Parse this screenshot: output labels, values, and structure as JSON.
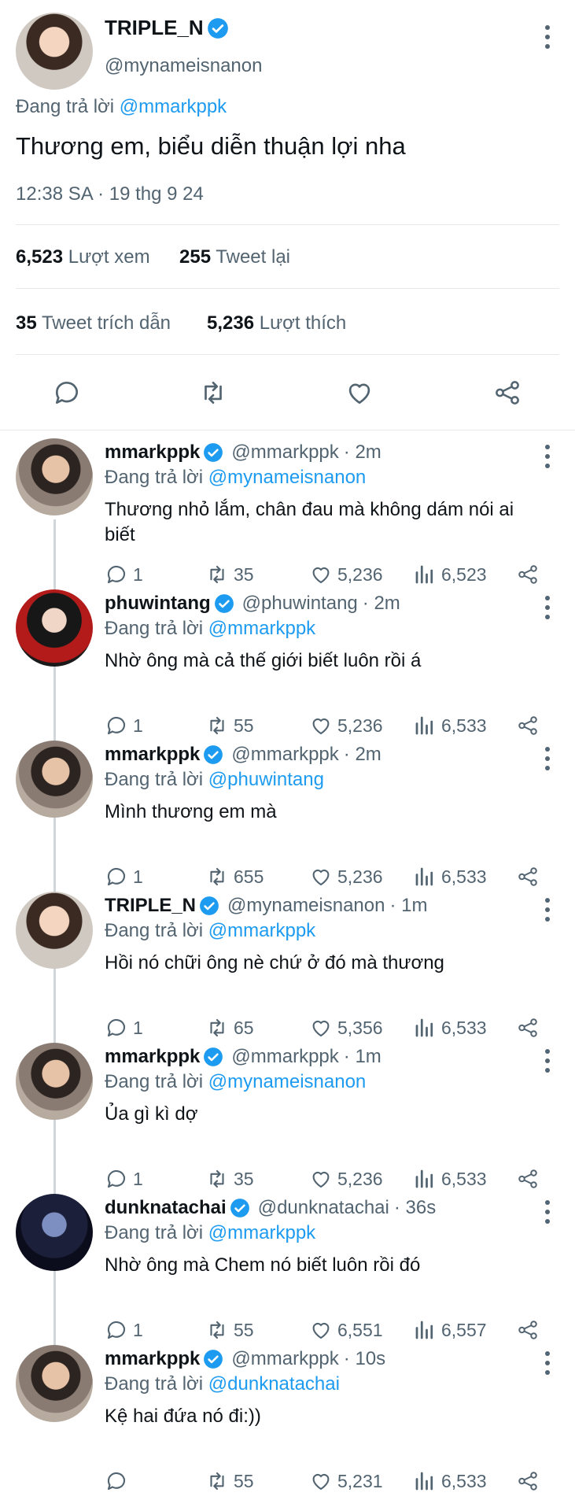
{
  "main_tweet": {
    "display_name": "TRIPLE_N",
    "handle": "@mynameisnanon",
    "reply_prefix": "Đang trả lời",
    "reply_to": "@mmarkppk",
    "text": "Thương em, biểu diễn thuận lợi nha",
    "timestamp": "12:38 SA · 19 thg 9 24",
    "views_count": "6,523",
    "views_label": "Lượt xem",
    "retweets_count": "255",
    "retweets_label": "Tweet lại",
    "quotes_count": "35",
    "quotes_label": "Tweet trích dẫn",
    "likes_count": "5,236",
    "likes_label": "Lượt thích"
  },
  "replies": [
    {
      "display_name": "mmarkppk",
      "handle": "@mmarkppk",
      "time": "· 2m",
      "reply_prefix": "Đang trả lời",
      "reply_to": "@mynameisnanon",
      "text_line1": "Thương nhỏ lắm, chân đau mà không dám nói ai",
      "text_line2": "biết",
      "replies": "1",
      "retweets": "35",
      "likes": "5,236",
      "views": "6,523"
    },
    {
      "display_name": "phuwintang",
      "handle": "@phuwintang",
      "time": "· 2m",
      "reply_prefix": "Đang trả lời",
      "reply_to": "@mmarkppk",
      "text_line1": "Nhờ ông mà cả thế giới biết luôn rồi á",
      "text_line2": "",
      "replies": "1",
      "retweets": "55",
      "likes": "5,236",
      "views": "6,533"
    },
    {
      "display_name": "mmarkppk",
      "handle": "@mmarkppk",
      "time": "· 2m",
      "reply_prefix": "Đang trả lời",
      "reply_to": "@phuwintang",
      "text_line1": "Mình thương em mà",
      "text_line2": "",
      "replies": "1",
      "retweets": "655",
      "likes": "5,236",
      "views": "6,533"
    },
    {
      "display_name": "TRIPLE_N",
      "handle": "@mynameisnanon",
      "time": "· 1m",
      "reply_prefix": "Đang trả lời",
      "reply_to": "@mmarkppk",
      "text_line1": "Hồi nó chữi ông nè chứ ở đó mà thương",
      "text_line2": "",
      "replies": "1",
      "retweets": "65",
      "likes": "5,356",
      "views": "6,533"
    },
    {
      "display_name": "mmarkppk",
      "handle": "@mmarkppk",
      "time": "· 1m",
      "reply_prefix": "Đang trả lời",
      "reply_to": "@mynameisnanon",
      "text_line1": "Ủa gì kì dợ",
      "text_line2": "",
      "replies": "1",
      "retweets": "35",
      "likes": "5,236",
      "views": "6,533"
    },
    {
      "display_name": "dunknatachai",
      "handle": "@dunknatachai",
      "time": "· 36s",
      "reply_prefix": "Đang trả lời",
      "reply_to": "@mmarkppk",
      "text_line1": "Nhờ ông mà Chem nó biết luôn rồi đó",
      "text_line2": "",
      "replies": "1",
      "retweets": "55",
      "likes": "6,551",
      "views": "6,557"
    },
    {
      "display_name": "mmarkppk",
      "handle": "@mmarkppk",
      "time": "· 10s",
      "reply_prefix": "Đang trả lời",
      "reply_to": "@dunknatachai",
      "text_line1": "Kệ hai đứa nó đi:))",
      "text_line2": "",
      "replies": "",
      "retweets": "55",
      "likes": "5,231",
      "views": "6,533"
    }
  ],
  "colors": {
    "accent": "#1d9bf0",
    "text": "#0f1419",
    "secondary": "#536471",
    "divider": "#e6e9eb"
  },
  "icons": {
    "verified": "verified-badge-icon",
    "more": "more-vertical-icon",
    "reply": "reply-bubble-icon",
    "retweet": "retweet-icon",
    "like": "heart-icon",
    "views": "views-bar-chart-icon",
    "share": "share-icon"
  }
}
